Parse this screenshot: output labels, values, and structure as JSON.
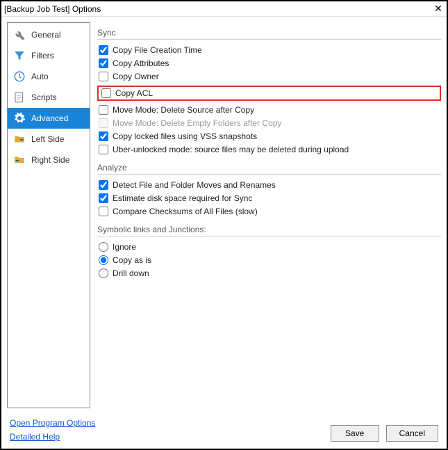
{
  "titlebar": {
    "text": "[Backup Job Test] Options"
  },
  "sidebar": {
    "items": [
      {
        "label": "General",
        "icon": "wrench"
      },
      {
        "label": "Filters",
        "icon": "funnel"
      },
      {
        "label": "Auto",
        "icon": "clock"
      },
      {
        "label": "Scripts",
        "icon": "script"
      },
      {
        "label": "Advanced",
        "icon": "gear",
        "selected": true
      },
      {
        "label": "Left Side",
        "icon": "folder-right"
      },
      {
        "label": "Right Side",
        "icon": "folder-left"
      }
    ]
  },
  "panel": {
    "sync": {
      "header": "Sync",
      "copy_creation": {
        "label": "Copy File Creation Time",
        "checked": true
      },
      "copy_attr": {
        "label": "Copy Attributes",
        "checked": true
      },
      "copy_owner": {
        "label": "Copy Owner",
        "checked": false
      },
      "copy_acl": {
        "label": "Copy ACL",
        "checked": false,
        "highlight": true
      },
      "move_mode": {
        "label": "Move Mode: Delete Source after Copy",
        "checked": false
      },
      "move_mode_empty": {
        "label": "Move Mode: Delete Empty Folders after Copy",
        "checked": false,
        "disabled": true
      },
      "vss": {
        "label": "Copy locked files using VSS snapshots",
        "checked": true
      },
      "uber": {
        "label": "Uber-unlocked mode: source files may be deleted during upload",
        "checked": false
      }
    },
    "analyze": {
      "header": "Analyze",
      "detect": {
        "label": "Detect File and Folder Moves and Renames",
        "checked": true
      },
      "estimate": {
        "label": "Estimate disk space required for Sync",
        "checked": true
      },
      "checksums": {
        "label": "Compare Checksums of All Files (slow)",
        "checked": false
      }
    },
    "symlinks": {
      "header": "Symbolic links and Junctions:",
      "ignore": "Ignore",
      "copy": "Copy as is",
      "drill": "Drill down",
      "selected": "copy"
    }
  },
  "footer": {
    "open_options": "Open Program Options",
    "detailed_help": "Detailed Help",
    "save": "Save",
    "cancel": "Cancel"
  }
}
